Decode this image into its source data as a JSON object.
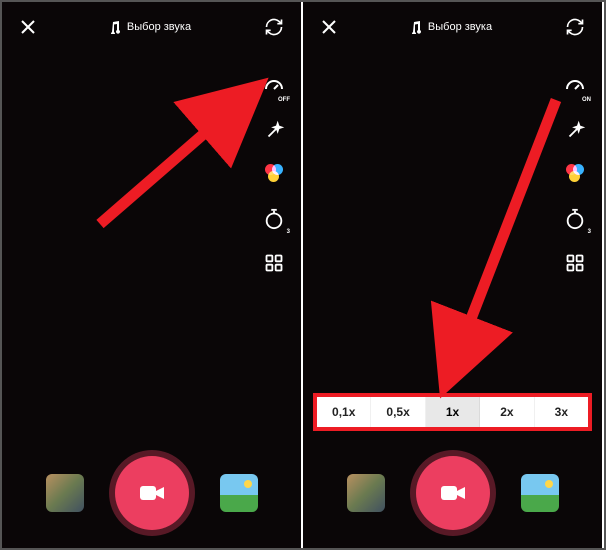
{
  "header": {
    "sound_label": "Выбор звука"
  },
  "side_tools": {
    "speed_badge_left": "OFF",
    "speed_badge_right": "ON",
    "timer_badge": "3"
  },
  "speed_options": [
    "0,1x",
    "0,5x",
    "1x",
    "2x",
    "3x"
  ],
  "speed_selected_index": 2,
  "colors": {
    "accent": "#ec3e60",
    "annotation": "#ed1c24"
  }
}
